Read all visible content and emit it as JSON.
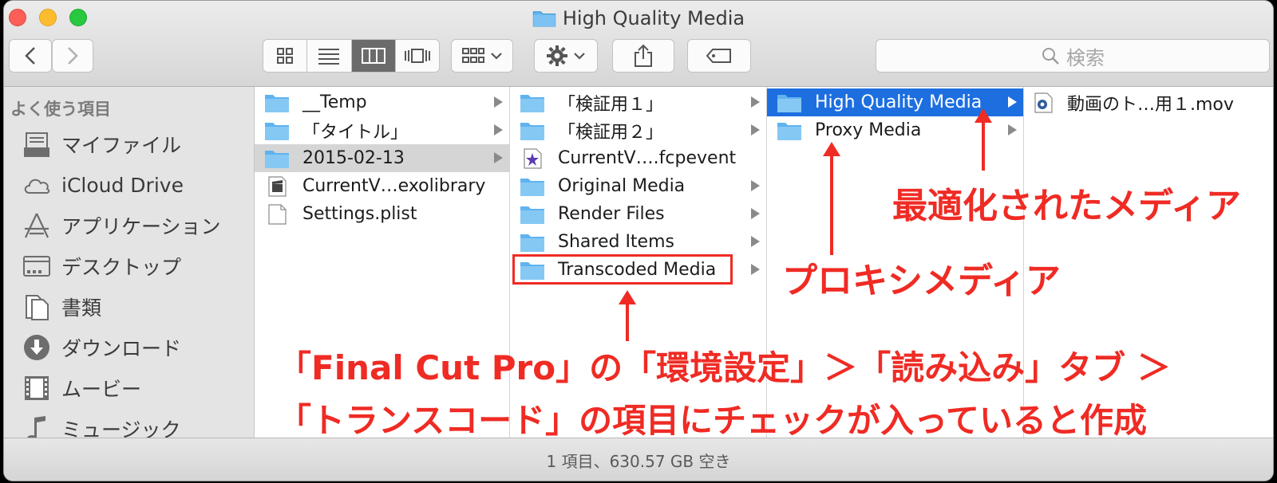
{
  "window": {
    "title": "High Quality Media"
  },
  "toolbar": {
    "search_placeholder": "検索"
  },
  "sidebar": {
    "header": "よく使う項目",
    "items": [
      {
        "label": "マイファイル",
        "icon": "all-files-icon"
      },
      {
        "label": "iCloud Drive",
        "icon": "cloud-icon"
      },
      {
        "label": "アプリケーション",
        "icon": "applications-icon"
      },
      {
        "label": "デスクトップ",
        "icon": "desktop-icon"
      },
      {
        "label": "書類",
        "icon": "documents-icon"
      },
      {
        "label": "ダウンロード",
        "icon": "download-icon"
      },
      {
        "label": "ムービー",
        "icon": "movies-icon"
      },
      {
        "label": "ミュージック",
        "icon": "music-icon"
      }
    ]
  },
  "columns": {
    "col1": [
      {
        "name": "__Temp",
        "type": "folder"
      },
      {
        "name": "「タイトル」",
        "type": "folder"
      },
      {
        "name": "2015-02-13",
        "type": "folder"
      },
      {
        "name": "CurrentV…exolibrary",
        "type": "file-clapper"
      },
      {
        "name": "Settings.plist",
        "type": "file"
      }
    ],
    "col2": [
      {
        "name": "「検証用１」",
        "type": "folder"
      },
      {
        "name": "「検証用２」",
        "type": "folder"
      },
      {
        "name": "CurrentV….fcpevent",
        "type": "file-star"
      },
      {
        "name": "Original Media",
        "type": "folder"
      },
      {
        "name": "Render Files",
        "type": "folder"
      },
      {
        "name": "Shared Items",
        "type": "folder"
      },
      {
        "name": "Transcoded Media",
        "type": "folder"
      }
    ],
    "col3": [
      {
        "name": "High Quality Media",
        "type": "folder"
      },
      {
        "name": "Proxy Media",
        "type": "folder"
      }
    ],
    "col4": [
      {
        "name": "動画のト…用１.mov",
        "type": "file-movie"
      }
    ]
  },
  "status": {
    "text": "1 項目、630.57 GB 空き"
  },
  "annotations": {
    "optimized": "最適化されたメディア",
    "proxy": "プロキシメディア",
    "line1": "「Final Cut Pro」の「環境設定」＞「読み込み」タブ ＞",
    "line2": "「トランスコード」の項目にチェックが入っていると作成"
  },
  "colors": {
    "selection_blue": "#1d6fe0",
    "annotation_red": "#ef2b24",
    "folder_blue": "#5fb3ef"
  }
}
